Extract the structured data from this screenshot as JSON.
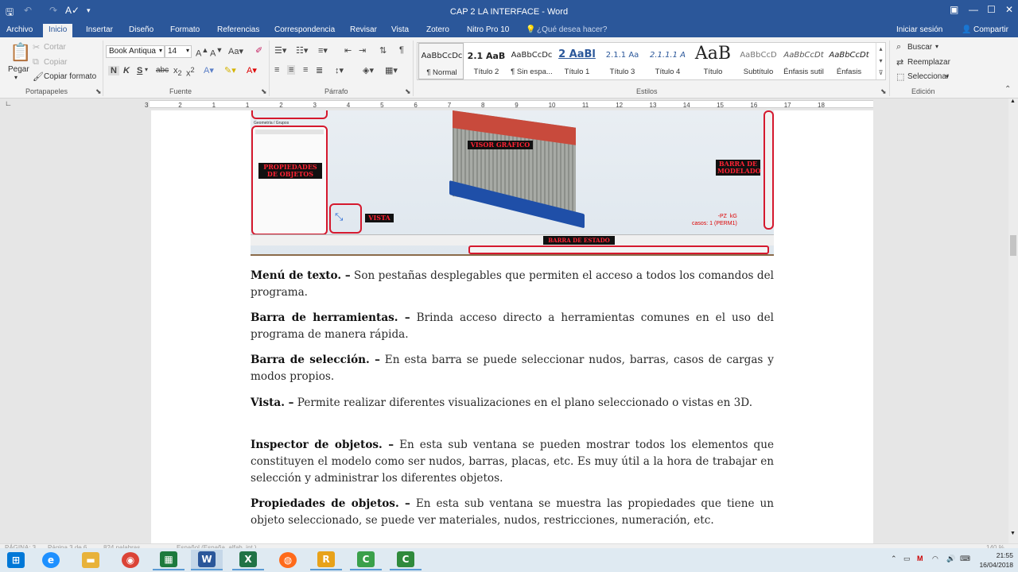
{
  "window": {
    "title": "CAP 2 LA INTERFACE - Word"
  },
  "qat": {
    "save_icon": "save-icon",
    "undo_icon": "undo-icon",
    "redo_icon": "redo-icon",
    "format_icon": "spellcheck-icon",
    "customize_icon": "chevron-down-icon"
  },
  "tabs": {
    "archivo": "Archivo",
    "inicio": "Inicio",
    "insertar": "Insertar",
    "diseno": "Diseño",
    "formato": "Formato",
    "referencias": "Referencias",
    "correspondencia": "Correspondencia",
    "revisar": "Revisar",
    "vista": "Vista",
    "zotero": "Zotero",
    "nitro": "Nitro Pro 10",
    "tell_me": "¿Qué desea hacer?",
    "signin": "Iniciar sesión",
    "share": "Compartir"
  },
  "ribbon": {
    "clipboard": {
      "paste": "Pegar",
      "cut": "Cortar",
      "copy": "Copiar",
      "format_painter": "Copiar formato",
      "group": "Portapapeles"
    },
    "font": {
      "name": "Book Antiqua",
      "size": "14",
      "group": "Fuente"
    },
    "paragraph": {
      "group": "Párrafo"
    },
    "styles": {
      "group": "Estilos",
      "items": [
        {
          "sample": "AaBbCcDc",
          "name": "¶ Normal"
        },
        {
          "sample": "2.1  AaB",
          "name": "Título 2"
        },
        {
          "sample": "AaBbCcDc",
          "name": "¶ Sin espa..."
        },
        {
          "sample": "2  AaBl",
          "name": "Título 1"
        },
        {
          "sample": "2.1.1  Aa",
          "name": "Título 3"
        },
        {
          "sample": "2.1.1.1  A",
          "name": "Título 4"
        },
        {
          "sample": "AaB",
          "name": "Título"
        },
        {
          "sample": "AaBbCcD",
          "name": "Subtítulo"
        },
        {
          "sample": "AaBbCcDt",
          "name": "Énfasis sutil"
        },
        {
          "sample": "AaBbCcDt",
          "name": "Énfasis"
        }
      ]
    },
    "editing": {
      "find": "Buscar",
      "replace": "Reemplazar",
      "select": "Seleccionar",
      "group": "Edición"
    }
  },
  "ruler": {
    "numbers": [
      "3",
      "2",
      "1",
      "1",
      "2",
      "3",
      "4",
      "5",
      "6",
      "7",
      "8",
      "9",
      "10",
      "11",
      "12",
      "13",
      "14",
      "15",
      "16",
      "17",
      "18"
    ]
  },
  "figure": {
    "labels": {
      "visor": "VISOR GRÁFICO",
      "propiedades": "PROPIEDADES\nDE OBJETOS",
      "vista": "VISTA",
      "barra_modelado": "BARRA DE\nMODELADO",
      "barra_estado": "BARRA DE ESTADO",
      "loadcase": "-PZ  kG\ncasos: 1 (PERM1)",
      "geometry_tab": "Geometría",
      "groups_tab": "Grupos"
    }
  },
  "paragraphs": [
    {
      "term": "Menú de texto. –",
      "text": " Son pestañas desplegables que permiten el acceso a todos los comandos del programa."
    },
    {
      "term": "Barra de herramientas. –",
      "text": " Brinda acceso directo a herramientas comunes en el uso del programa de manera rápida."
    },
    {
      "term": "Barra de selección. –",
      "text": " En esta barra se puede seleccionar nudos, barras, casos de cargas y modos propios."
    },
    {
      "term": "Vista. –",
      "text": " Permite realizar diferentes visualizaciones en el plano seleccionado o vistas en 3D."
    },
    {
      "term": "Inspector de objetos. –",
      "text": " En esta sub ventana se pueden mostrar todos los elementos que constituyen el modelo como ser nudos, barras, placas, etc. Es muy útil a la hora de trabajar en selección y administrar los diferentes objetos."
    },
    {
      "term": "Propiedades de objetos. –",
      "text": " En esta sub ventana se muestra las propiedades que tiene un objeto seleccionado, se puede ver materiales, nudos, restricciones, numeración, etc."
    }
  ],
  "statusbar": {
    "page": "PÁGINA: 3",
    "pages": "Página 3 de 6",
    "words": "824 palabras",
    "language": "Español (España, alfab. int.)",
    "zoom": "140 %"
  },
  "taskbar": {
    "time": "21:55",
    "date": "16/04/2018",
    "apps": [
      {
        "icon": "windows-start-icon",
        "label": "⊞"
      },
      {
        "icon": "internet-explorer-icon",
        "label": "e"
      },
      {
        "icon": "file-explorer-icon",
        "label": "▬"
      },
      {
        "icon": "chrome-icon",
        "label": "◉"
      },
      {
        "icon": "spreadsheet-app-icon",
        "label": "▦"
      },
      {
        "icon": "word-icon",
        "label": "W"
      },
      {
        "icon": "excel-icon",
        "label": "X"
      },
      {
        "icon": "firefox-icon",
        "label": "◍"
      },
      {
        "icon": "robot-app-icon",
        "label": "R"
      },
      {
        "icon": "green-c-app-icon",
        "label": "C"
      },
      {
        "icon": "green-c-app-2-icon",
        "label": "C"
      }
    ],
    "colors": [
      "#0078d7",
      "#1e90ff",
      "#e8b23a",
      "#db4437",
      "#1d7a3d",
      "#2b579a",
      "#217346",
      "#ff6a1a",
      "#e8a21a",
      "#3aa04a",
      "#2f8a3c"
    ]
  }
}
